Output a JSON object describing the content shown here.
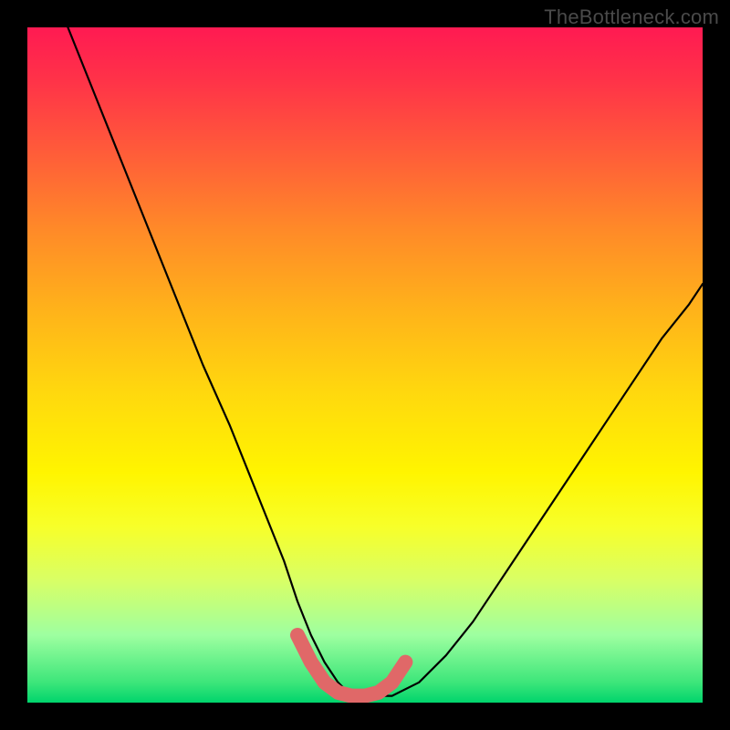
{
  "watermark": "TheBottleneck.com",
  "chart_data": {
    "type": "line",
    "title": "",
    "xlabel": "",
    "ylabel": "",
    "xlim": [
      0,
      100
    ],
    "ylim": [
      0,
      100
    ],
    "series": [
      {
        "name": "bottleneck-curve",
        "x": [
          6,
          10,
          14,
          18,
          22,
          26,
          30,
          34,
          36,
          38,
          40,
          42,
          44,
          46,
          48,
          50,
          54,
          58,
          62,
          66,
          70,
          74,
          78,
          82,
          86,
          90,
          94,
          98,
          100
        ],
        "y": [
          100,
          90,
          80,
          70,
          60,
          50,
          41,
          31,
          26,
          21,
          15,
          10,
          6,
          3,
          1,
          1,
          1,
          3,
          7,
          12,
          18,
          24,
          30,
          36,
          42,
          48,
          54,
          59,
          62
        ]
      },
      {
        "name": "highlight-region",
        "x": [
          40,
          42,
          44,
          46,
          48,
          50,
          52,
          54,
          56
        ],
        "y": [
          10,
          6,
          3,
          1.5,
          1,
          1,
          1.5,
          3,
          6
        ]
      }
    ],
    "colors": {
      "curve": "#000000",
      "highlight": "#e06868"
    }
  }
}
